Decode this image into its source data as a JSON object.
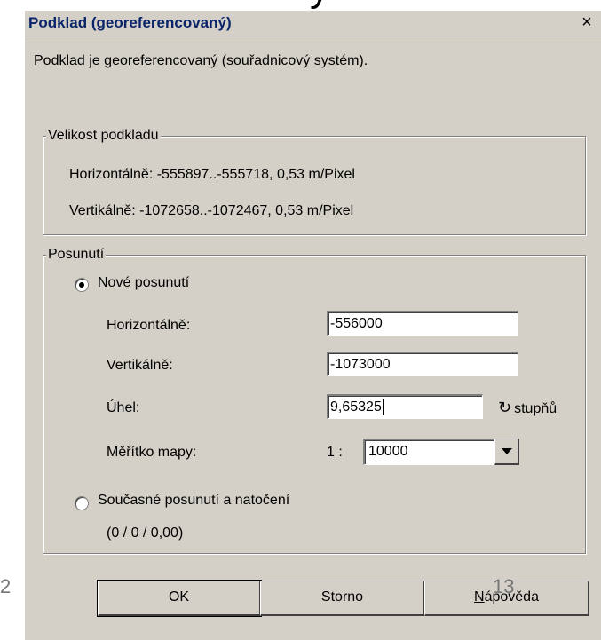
{
  "slide": {
    "title_fragment": "y",
    "page_left": "2",
    "page_right": "13"
  },
  "dialog": {
    "title": "Podklad (georeferencovaný)",
    "close_label": "×",
    "intro": "Podklad je georeferencovaný (souřadnicový systém).",
    "size_group": {
      "legend": "Velikost podkladu",
      "horizontal": "Horizontálně: -555897..-555718,  0,53 m/Pixel",
      "vertical": "Vertikálně: -1072658..-1072467,  0,53 m/Pixel"
    },
    "shift_group": {
      "legend": "Posunutí",
      "option_new": "Nové posunutí",
      "option_current": "Současné posunutí a natočení",
      "current_values": "(0 / 0 / 0,00)",
      "fields": {
        "horizontal_label": "Horizontálně:",
        "horizontal_value": "-556000",
        "vertical_label": "Vertikálně:",
        "vertical_value": "-1073000",
        "angle_label": "Úhel:",
        "angle_value": "9,65325",
        "angle_unit": "stupňů",
        "scale_label": "Měřítko mapy:",
        "scale_prefix": "1 :",
        "scale_value": "10000"
      }
    },
    "buttons": {
      "ok": "OK",
      "cancel": "Storno",
      "help_mnemonic": "N",
      "help_rest": "ápověda"
    }
  }
}
